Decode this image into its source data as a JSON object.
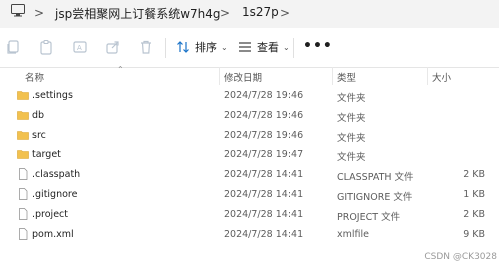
{
  "address_bar": {
    "crumbs": [
      "jsp尝相聚网上订餐系统w7h4g",
      "1s27p"
    ],
    "separator": ">"
  },
  "toolbar": {
    "sort_label": "排序",
    "view_label": "查看",
    "more_label": "•••"
  },
  "columns": {
    "name": "名称",
    "modified": "修改日期",
    "type": "类型",
    "size": "大小"
  },
  "files": [
    {
      "name": ".settings",
      "modified": "2024/7/28 19:46",
      "type": "文件夹",
      "size": "",
      "icon": "folder-icon"
    },
    {
      "name": "db",
      "modified": "2024/7/28 19:46",
      "type": "文件夹",
      "size": "",
      "icon": "folder-icon"
    },
    {
      "name": "src",
      "modified": "2024/7/28 19:46",
      "type": "文件夹",
      "size": "",
      "icon": "folder-icon"
    },
    {
      "name": "target",
      "modified": "2024/7/28 19:47",
      "type": "文件夹",
      "size": "",
      "icon": "folder-icon"
    },
    {
      "name": ".classpath",
      "modified": "2024/7/28 14:41",
      "type": "CLASSPATH 文件",
      "size": "2 KB",
      "icon": "file-icon"
    },
    {
      "name": ".gitignore",
      "modified": "2024/7/28 14:41",
      "type": "GITIGNORE 文件",
      "size": "1 KB",
      "icon": "file-icon"
    },
    {
      "name": ".project",
      "modified": "2024/7/28 14:41",
      "type": "PROJECT 文件",
      "size": "2 KB",
      "icon": "file-icon"
    },
    {
      "name": "pom.xml",
      "modified": "2024/7/28 14:41",
      "type": "xmlfile",
      "size": "9 KB",
      "icon": "file-icon"
    }
  ],
  "watermark": "CSDN @CK3028",
  "colors": {
    "folder": "#f2c14e",
    "address_bg": "#f3f3f3",
    "accent": "#1a73c8"
  }
}
